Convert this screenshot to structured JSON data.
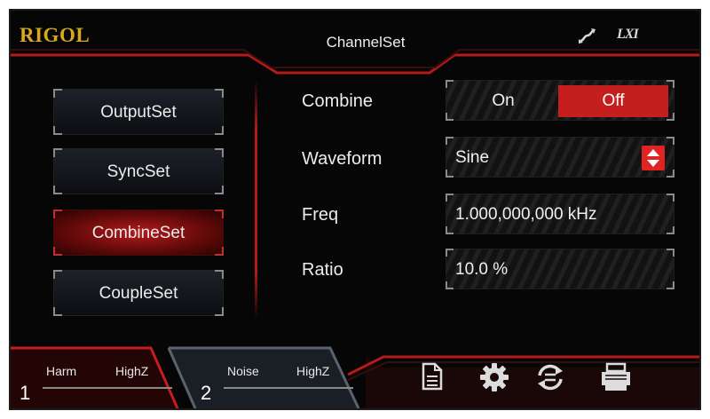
{
  "brand": "RIGOL",
  "page_title": "ChannelSet",
  "status_icons": {
    "usb": {
      "icon": "usb-icon",
      "glyph": "ঽ"
    },
    "lxi": {
      "icon": "lxi-icon",
      "text": "LXI"
    }
  },
  "nav": {
    "items": [
      {
        "label": "OutputSet",
        "active": false
      },
      {
        "label": "SyncSet",
        "active": false
      },
      {
        "label": "CombineSet",
        "active": true
      },
      {
        "label": "CoupleSet",
        "active": false
      }
    ]
  },
  "params": {
    "combine": {
      "label": "Combine",
      "on_label": "On",
      "off_label": "Off",
      "selected": "Off"
    },
    "waveform": {
      "label": "Waveform",
      "value": "Sine"
    },
    "freq": {
      "label": "Freq",
      "value": "1.000,000,000 kHz"
    },
    "ratio": {
      "label": "Ratio",
      "value": "10.0 %"
    }
  },
  "channels": [
    {
      "number": "1",
      "mode": "Harm",
      "impedance": "HighZ",
      "active": true
    },
    {
      "number": "2",
      "mode": "Noise",
      "impedance": "HighZ",
      "active": false
    }
  ],
  "toolbar": [
    {
      "icon": "document-icon"
    },
    {
      "icon": "gear-icon"
    },
    {
      "icon": "sync-icon"
    },
    {
      "icon": "printer-icon"
    }
  ],
  "colors": {
    "accent_red": "#c41e1e",
    "brand_gold": "#d9a81e",
    "background": "#060606"
  }
}
